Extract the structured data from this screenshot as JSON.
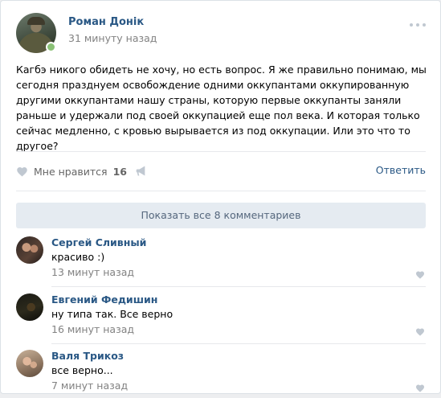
{
  "post": {
    "author": "Роман Донік",
    "time": "31 минуту назад",
    "text": "Кагбэ никого обидеть не хочу, но есть вопрос. Я же правильно понимаю, мы сегодня празднуем освобождение одними оккупантами оккупированную другими оккупантами нашу страны, которую первые оккупанты заняли раньше и удержали под своей оккупацией еще пол века. И которая только сейчас медленно, с кровью вырывается из под оккупации. Или это что то другое?",
    "like_label": "Мне нравится",
    "like_count": "16",
    "reply_label": "Ответить"
  },
  "comments_section": {
    "show_all_label": "Показать все 8 комментариев",
    "comments": [
      {
        "author": "Сергей Сливный",
        "text": "красиво :)",
        "time": "13 минут назад"
      },
      {
        "author": "Евгений Федишин",
        "text": "ну типа так. Все верно",
        "time": "16 минут назад"
      },
      {
        "author": "Валя Трикоз",
        "text": "все верно...",
        "time": "7 минут назад"
      }
    ]
  },
  "icons": {
    "more": "more-dots-icon",
    "like": "heart-icon",
    "share": "megaphone-share-icon"
  },
  "colors": {
    "link": "#2a5885",
    "muted": "#828282",
    "online": "#8ac176",
    "icon": "#c0c8d1",
    "show_all_bg": "#e5ebf1"
  }
}
